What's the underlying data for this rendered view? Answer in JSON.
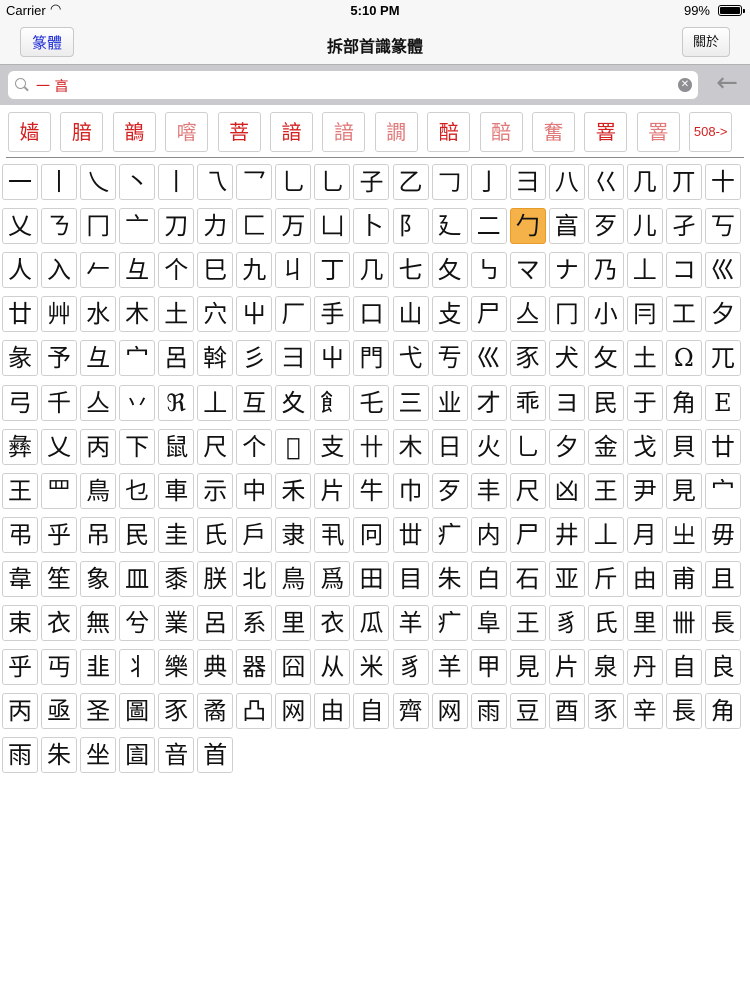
{
  "status": {
    "carrier": "Carrier",
    "time": "5:10 PM",
    "battery": "99%",
    "battery_level": 0.99
  },
  "nav": {
    "left_button": "篆體",
    "title": "拆部首識篆體",
    "right_button": "關於"
  },
  "search": {
    "value": "一 亯",
    "clear_icon": "clear-icon",
    "back_icon": "back-arrow-icon"
  },
  "candidates": [
    {
      "char": "嫱",
      "light": false
    },
    {
      "char": "腤",
      "light": false
    },
    {
      "char": "鶕",
      "light": false
    },
    {
      "char": "噾",
      "light": true
    },
    {
      "char": "菩",
      "light": false
    },
    {
      "char": "諳",
      "light": false
    },
    {
      "char": "諳",
      "light": true
    },
    {
      "char": "譋",
      "light": true
    },
    {
      "char": "醅",
      "light": false
    },
    {
      "char": "醅",
      "light": true
    },
    {
      "char": "奮",
      "light": true
    },
    {
      "char": "罯",
      "light": false
    },
    {
      "char": "罯",
      "light": true
    },
    {
      "char": "508->",
      "light": false,
      "more": true
    }
  ],
  "selected_index": 32,
  "radicals": [
    "一",
    "丨",
    "乀",
    "丶",
    "丨",
    "乁",
    "乛",
    "乚",
    "乚",
    "子",
    "乙",
    "𠃌",
    "亅",
    "彐",
    "八",
    "巜",
    "几",
    "丌",
    "十",
    "乂",
    "ㄋ",
    "冂",
    "亠",
    "刀",
    "力",
    "匚",
    "万",
    "凵",
    "卜",
    "阝",
    "廴",
    "二",
    "勹",
    "亯",
    "歹",
    "儿",
    "孑",
    "丂",
    "人",
    "入",
    "𠂉",
    "彑",
    "个",
    "巳",
    "九",
    "丩",
    "丁",
    "几",
    "七",
    "夂",
    "㇉",
    "マ",
    "ナ",
    "乃",
    "丄",
    "コ",
    "巛",
    "廿",
    "艸",
    "水",
    "木",
    "土",
    "穴",
    "屮",
    "厂",
    "手",
    "口",
    "山",
    "攴",
    "尸",
    "亼",
    "冂",
    "小",
    "冃",
    "工",
    "夕",
    "彖",
    "予",
    "彑",
    "宀",
    "呂",
    "斡",
    "彡",
    "彐",
    "屮",
    "門",
    "弋",
    "亐",
    "巛",
    "豕",
    "犬",
    "攵",
    "土",
    "Ω",
    "兀",
    "弓",
    "千",
    "亼",
    "丷",
    "ℜ",
    "丄",
    "互",
    "夊",
    "飠",
    "乇",
    "三",
    "业",
    "才",
    "乖",
    "ヨ",
    "民",
    "于",
    "角",
    "Ε",
    "彝",
    "乂",
    "丙",
    "下",
    "鼠",
    "尺",
    "个",
    "𠃧",
    "支",
    "卄",
    "木",
    "日",
    "火",
    "乚",
    "夕",
    "金",
    "戈",
    "貝",
    "廿",
    "王",
    "罒",
    "鳥",
    "乜",
    "車",
    "示",
    "中",
    "禾",
    "片",
    "牛",
    "巾",
    "歹",
    "丰",
    "尺",
    "凶",
    "王",
    "尹",
    "見",
    "宀",
    "弔",
    "乎",
    "吊",
    "民",
    "圭",
    "氏",
    "戶",
    "隶",
    "丮",
    "冋",
    "丗",
    "疒",
    "内",
    "尸",
    "井",
    "丄",
    "月",
    "㞢",
    "毋",
    "韋",
    "笙",
    "象",
    "皿",
    "黍",
    "朕",
    "北",
    "鳥",
    "爲",
    "田",
    "目",
    "朱",
    "白",
    "石",
    "亚",
    "斤",
    "由",
    "甫",
    "且",
    "束",
    "衣",
    "無",
    "兮",
    "業",
    "呂",
    "系",
    "里",
    "衣",
    "瓜",
    "羊",
    "疒",
    "阜",
    "王",
    "豸",
    "氏",
    "里",
    "卌",
    "長",
    "乎",
    "丏",
    "韭",
    "丬",
    "樂",
    "典",
    "器",
    "囧",
    "从",
    "米",
    "豸",
    "羊",
    "甲",
    "見",
    "片",
    "泉",
    "丹",
    "自",
    "良",
    "丙",
    "亟",
    "圣",
    "圖",
    "豕",
    "矞",
    "凸",
    "网",
    "由",
    "自",
    "齊",
    "网",
    "雨",
    "豆",
    "酉",
    "豕",
    "辛",
    "長",
    "角",
    "雨",
    "朱",
    "坐",
    "圁",
    "音",
    "首"
  ]
}
